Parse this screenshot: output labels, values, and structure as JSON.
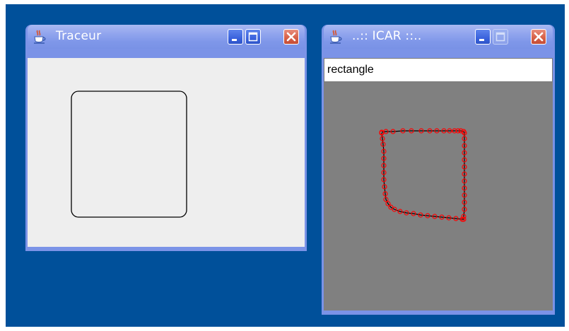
{
  "windows": [
    {
      "title": "Traceur",
      "icon": "java-coffee-icon"
    },
    {
      "title": "..:: ICAR ::..",
      "icon": "java-coffee-icon",
      "input_value": "rectangle"
    }
  ],
  "colors": {
    "desktop": "#00509a",
    "title_bar": "#7b93e7",
    "trace_points": "#ff0000",
    "canvas": "#808080"
  }
}
